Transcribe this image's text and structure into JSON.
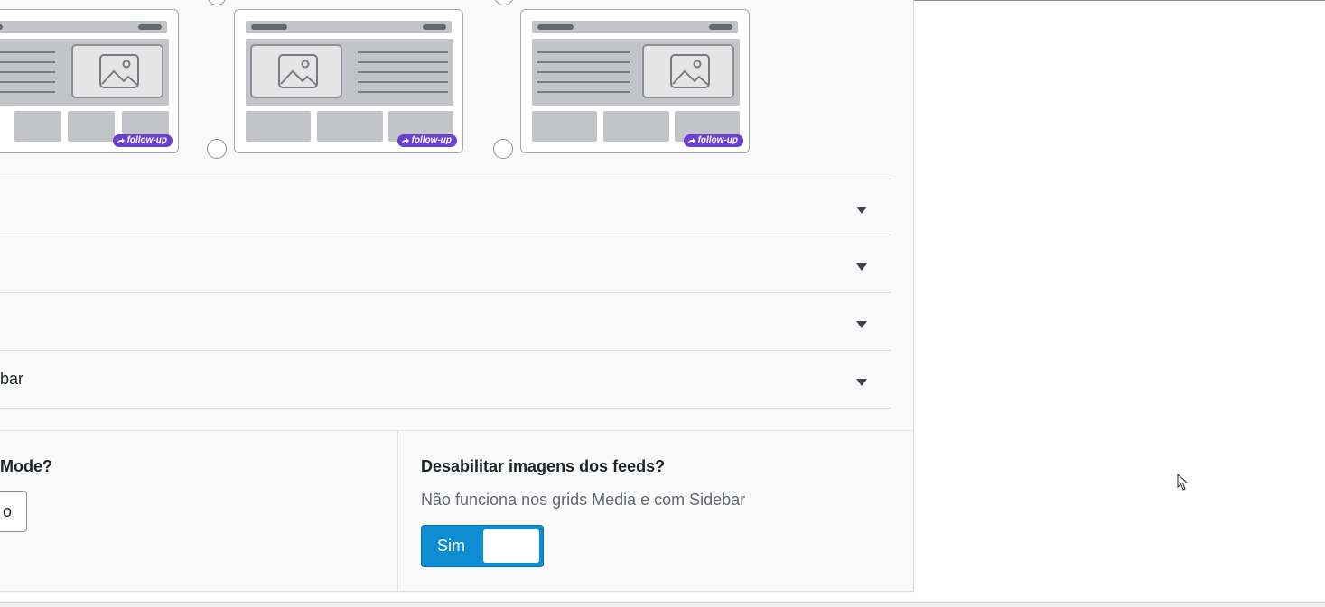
{
  "layout_cards": [
    {
      "badge": "follow-up"
    },
    {
      "badge": "follow-up"
    },
    {
      "badge": "follow-up"
    }
  ],
  "accordion": [
    {
      "label": ""
    },
    {
      "label": ""
    },
    {
      "label": ""
    },
    {
      "label": "bar"
    }
  ],
  "settings": {
    "left": {
      "title": "Mode?",
      "button_label": "o"
    },
    "right": {
      "title": "Desabilitar imagens dos feeds?",
      "description": "Não funciona nos grids Media e com Sidebar",
      "toggle_label": "Sim"
    }
  },
  "colors": {
    "accent": "#0f8dd3",
    "badge": "#6b3fd1"
  }
}
